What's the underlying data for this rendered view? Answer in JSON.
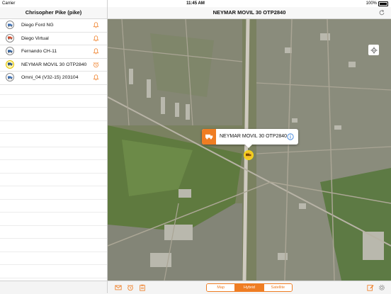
{
  "status_bar": {
    "carrier": "Carrier",
    "time": "11:45 AM",
    "battery": "100%"
  },
  "sidebar": {
    "title": "Chrisopher Pike (pike)",
    "vehicles": [
      {
        "label": "Diego Ford NG",
        "alert_icon": "bell-icon",
        "active": false
      },
      {
        "label": "Diego Virtual",
        "alert_icon": "bell-icon",
        "active": false
      },
      {
        "label": "Fernando CH-11",
        "alert_icon": "bell-icon",
        "active": false
      },
      {
        "label": "NEYMAR MOVIL 30 OTP2840",
        "alert_icon": "alarm-clock-icon",
        "active": true
      },
      {
        "label": "Omni_04 (V32-15) 203104",
        "alert_icon": "bell-icon",
        "active": false
      }
    ]
  },
  "map_header": {
    "title": "NEYMAR MOVIL 30 OTP2840",
    "refresh_icon": "refresh-icon"
  },
  "map": {
    "callout_title": "NEYMAR MOVIL 30 OTP2840",
    "info_icon": "info-icon",
    "locate_icon": "locate-icon"
  },
  "toolbar": {
    "left_icons": [
      "mail-icon",
      "alarm-clock-icon",
      "clipboard-icon"
    ],
    "right_icons": [
      "edit-icon",
      "gear-icon"
    ],
    "segments": {
      "map": "Map",
      "hybrid": "Hybrid",
      "satellite": "Satellite",
      "selected": "Hybrid"
    }
  },
  "colors": {
    "accent": "#EF7D23",
    "active_vehicle": "#F2D31A"
  }
}
